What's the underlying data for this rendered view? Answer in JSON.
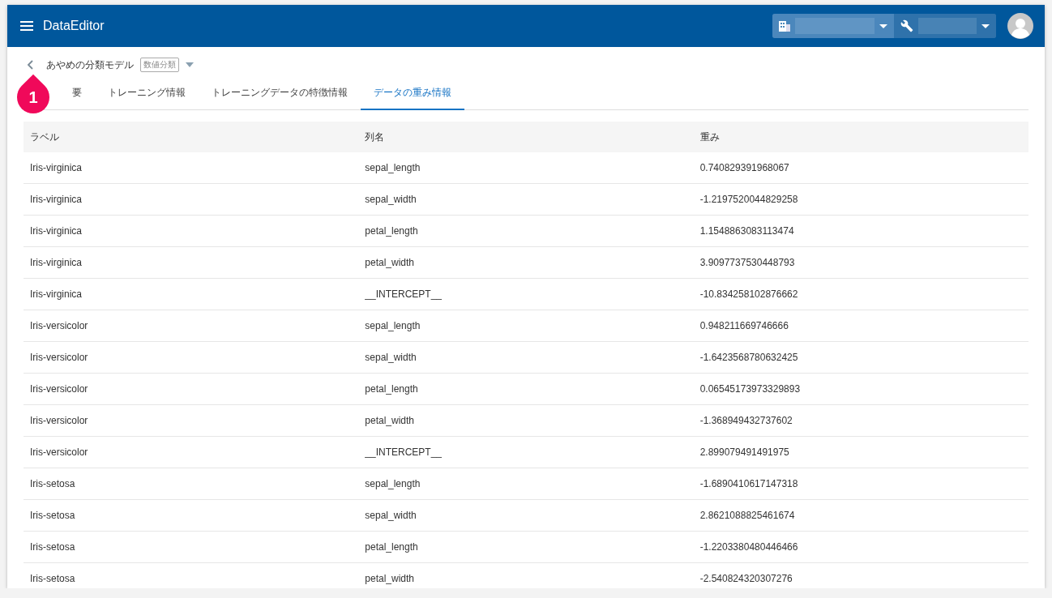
{
  "app": {
    "title": "DataEditor"
  },
  "model": {
    "name": "あやめの分類モデル",
    "tag": "数値分類"
  },
  "callout": {
    "number": "1"
  },
  "tabs": [
    {
      "label": "要",
      "selected": false
    },
    {
      "label": "トレーニング情報",
      "selected": false
    },
    {
      "label": "トレーニングデータの特徴情報",
      "selected": false
    },
    {
      "label": "データの重み情報",
      "selected": true
    }
  ],
  "table": {
    "columns": [
      "ラベル",
      "列名",
      "重み"
    ],
    "rows": [
      [
        "Iris-virginica",
        "sepal_length",
        "0.740829391968067"
      ],
      [
        "Iris-virginica",
        "sepal_width",
        "-1.2197520044829258"
      ],
      [
        "Iris-virginica",
        "petal_length",
        "1.1548863083113474"
      ],
      [
        "Iris-virginica",
        "petal_width",
        "3.9097737530448793"
      ],
      [
        "Iris-virginica",
        "__INTERCEPT__",
        "-10.834258102876662"
      ],
      [
        "Iris-versicolor",
        "sepal_length",
        "0.948211669746666"
      ],
      [
        "Iris-versicolor",
        "sepal_width",
        "-1.6423568780632425"
      ],
      [
        "Iris-versicolor",
        "petal_length",
        "0.06545173973329893"
      ],
      [
        "Iris-versicolor",
        "petal_width",
        "-1.368949432737602"
      ],
      [
        "Iris-versicolor",
        "__INTERCEPT__",
        "2.899079491491975"
      ],
      [
        "Iris-setosa",
        "sepal_length",
        "-1.6890410617147318"
      ],
      [
        "Iris-setosa",
        "sepal_width",
        "2.8621088825461674"
      ],
      [
        "Iris-setosa",
        "petal_length",
        "-1.2203380480446466"
      ],
      [
        "Iris-setosa",
        "petal_width",
        "-2.540824320307276"
      ]
    ]
  }
}
